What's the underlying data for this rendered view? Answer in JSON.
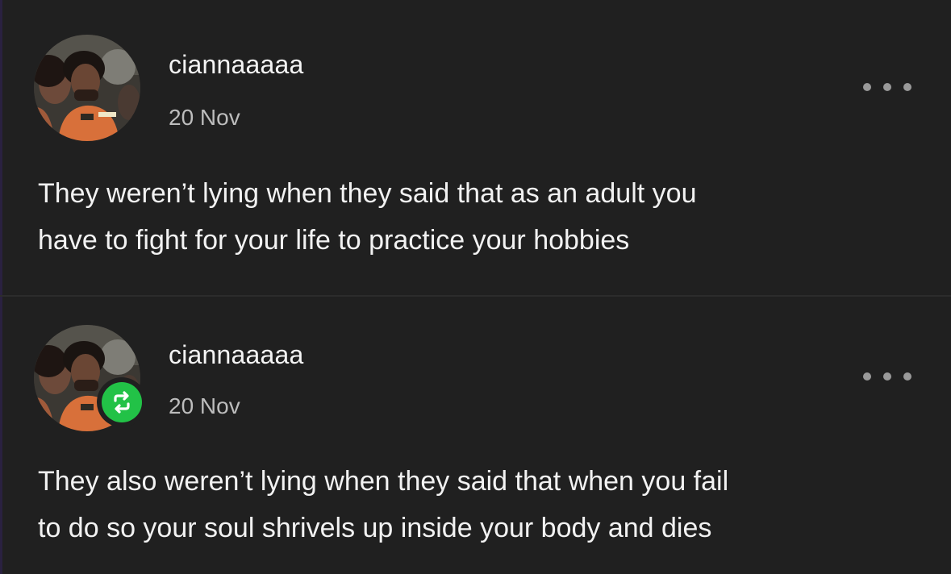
{
  "posts": [
    {
      "username": "ciannaaaaa",
      "date": "20 Nov",
      "text_lines": [
        "They weren’t lying when they said that as an adult you",
        "have to fight for your life to practice your hobbies"
      ],
      "reblogged": false,
      "more_icon": "ellipsis-icon"
    },
    {
      "username": "ciannaaaaa",
      "date": "20 Nov",
      "text_lines": [
        "They also weren’t lying when they said that when you fail",
        "to do so your soul shrivels up inside your body and dies"
      ],
      "reblogged": true,
      "reblog_icon": "reblog-icon",
      "reblog_color": "#22c247",
      "more_icon": "ellipsis-icon"
    }
  ],
  "colors": {
    "background": "#202020",
    "text": "#f2f2f2",
    "secondary_text": "#bdbdbd",
    "divider": "#2c2c2c"
  }
}
